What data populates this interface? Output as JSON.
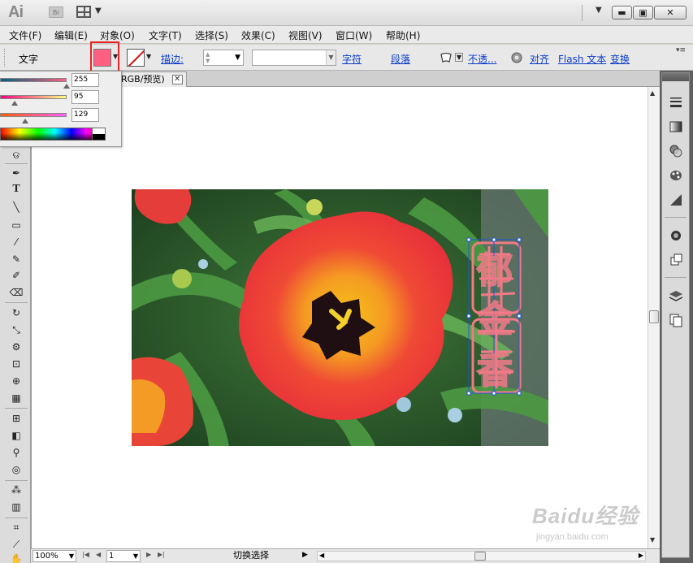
{
  "app": {
    "logo": "Ai",
    "bridge_logo": "Br"
  },
  "menu": [
    "文件(F)",
    "编辑(E)",
    "对象(O)",
    "文字(T)",
    "选择(S)",
    "效果(C)",
    "视图(V)",
    "窗口(W)",
    "帮助(H)"
  ],
  "controlbar": {
    "tool_label": "文字",
    "fill_color": "#ff5f81",
    "stroke_label": "描边:",
    "char_link": "字符",
    "para_link": "段落",
    "opacity_link": "不透...",
    "align_link": "对齐",
    "flash_link": "Flash 文本",
    "transform_link": "变换"
  },
  "color_panel": {
    "r": "255",
    "g": "95",
    "b": "129"
  },
  "document": {
    "tab_title": "RGB/预览)"
  },
  "statusbar": {
    "zoom": "100%",
    "page": "1",
    "mode": "切换选择"
  },
  "watermark": {
    "brand": "Baidu经验",
    "url": "jingyan.baidu.com"
  },
  "artwork": {
    "text_glyphs": [
      "郁",
      "金",
      "香"
    ],
    "text_stroke_color": "#f07a87",
    "selection_color": "#1f56d8"
  }
}
